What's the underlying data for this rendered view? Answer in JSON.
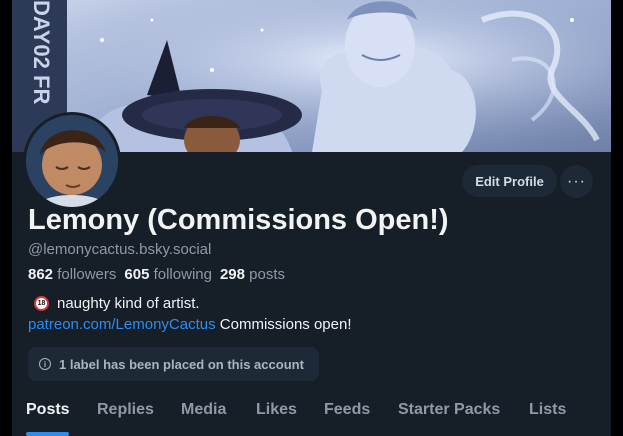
{
  "profile": {
    "display_name": "Lemony (Commissions Open!)",
    "handle": "@lemonycactus.bsky.social",
    "banner_text": "DAY02 FR",
    "stats": {
      "followers_count": "862",
      "followers_label": "followers",
      "following_count": "605",
      "following_label": "following",
      "posts_count": "298",
      "posts_label": "posts"
    },
    "bio": {
      "line1_badge": "18",
      "line1_text": "naughty kind of artist.",
      "link_text": "patreon.com/LemonyCactus",
      "line2_text": "Commissions open!"
    },
    "label_notice": "1 label has been placed on this account"
  },
  "actions": {
    "edit_profile": "Edit Profile",
    "more": "···"
  },
  "tabs": [
    {
      "label": "Posts",
      "active": true
    },
    {
      "label": "Replies",
      "active": false
    },
    {
      "label": "Media",
      "active": false
    },
    {
      "label": "Likes",
      "active": false
    },
    {
      "label": "Feeds",
      "active": false
    },
    {
      "label": "Starter Packs",
      "active": false
    },
    {
      "label": "Lists",
      "active": false
    }
  ],
  "icons": {
    "more": "ellipsis-icon",
    "info": "info-icon",
    "badge": "18-plus-icon"
  },
  "colors": {
    "background": "#161e27",
    "surface": "#1e2937",
    "link": "#2c8df1",
    "text_primary": "#f1f3f5",
    "text_secondary": "#8d9aa8"
  }
}
